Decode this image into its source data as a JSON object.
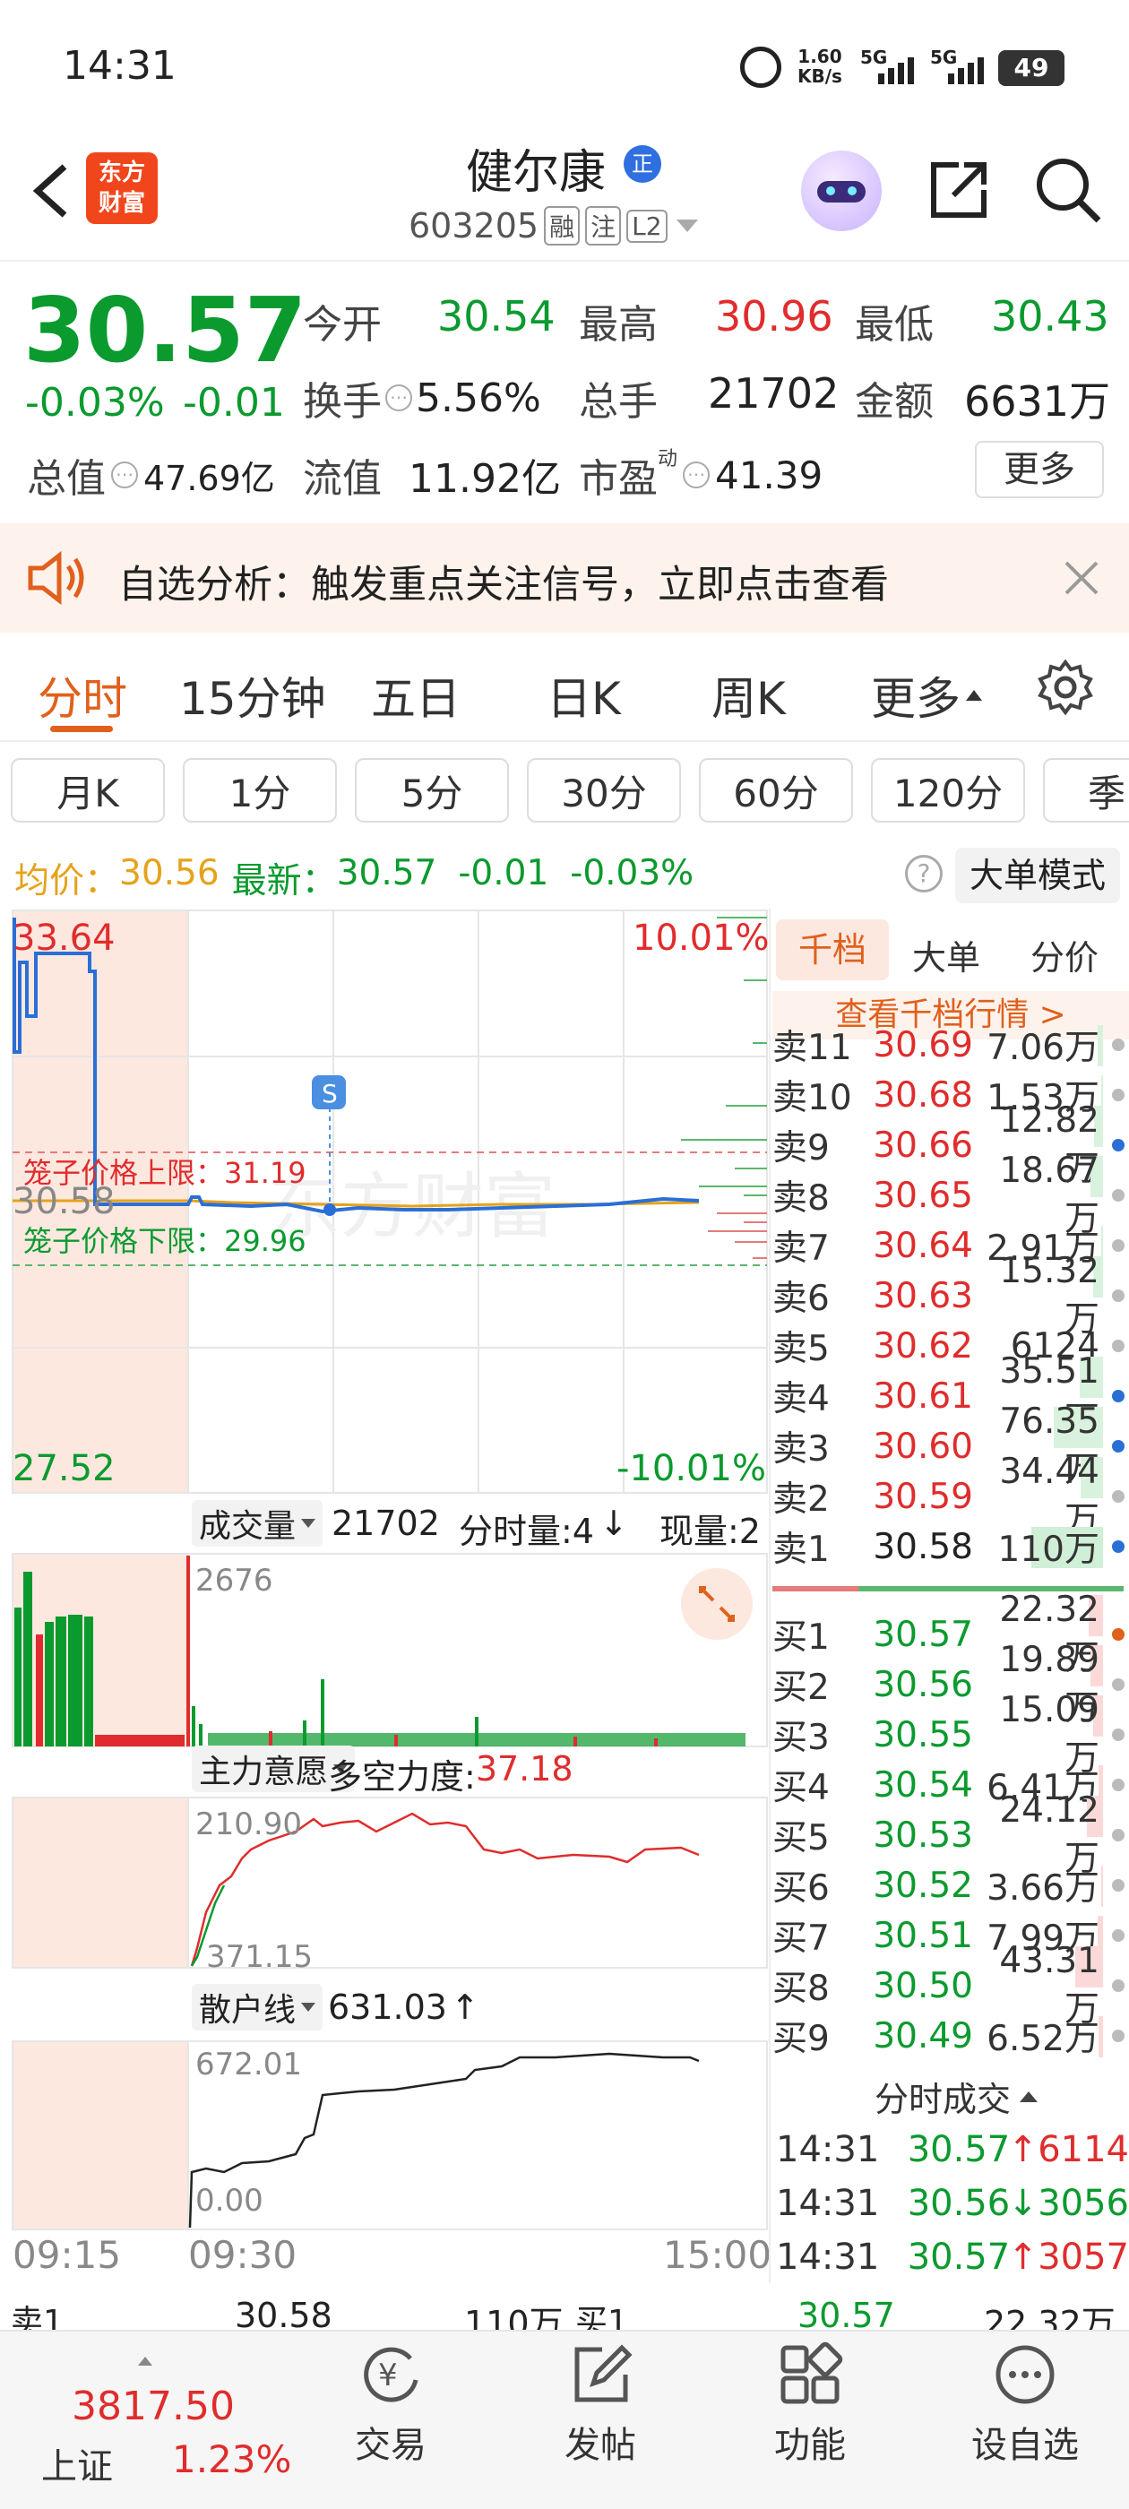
{
  "status_bar": {
    "time": "14:31",
    "speed_value": "1.60",
    "speed_unit": "KB/s",
    "net1": "5G",
    "net2": "5G",
    "battery": "49"
  },
  "header": {
    "logo_line1": "东方",
    "logo_line2": "财富",
    "stock_name": "健尔康",
    "badge": "正",
    "code": "603205",
    "tag_rong": "融",
    "tag_zhu": "注",
    "tag_l2": "L2"
  },
  "quote": {
    "price": "30.57",
    "change_pct": "-0.03%",
    "change": "-0.01",
    "open_label": "今开",
    "open": "30.54",
    "high_label": "最高",
    "high": "30.96",
    "low_label": "最低",
    "low": "30.43",
    "turnover_label": "换手",
    "turnover": "5.56%",
    "volume_label": "总手",
    "volume": "21702",
    "amount_label": "金额",
    "amount": "6631万",
    "mcap_label": "总值",
    "mcap": "47.69亿",
    "float_label": "流值",
    "float_cap": "11.92亿",
    "pe_label": "市盈",
    "pe_sup": "动",
    "pe": "41.39",
    "more_button": "更多"
  },
  "alert": {
    "text": "自选分析：触发重点关注信号，立即点击查看"
  },
  "tabs": [
    {
      "label": "分时"
    },
    {
      "label": "15分钟"
    },
    {
      "label": "五日"
    },
    {
      "label": "日K"
    },
    {
      "label": "周K"
    },
    {
      "label": "更多"
    }
  ],
  "subtabs": [
    {
      "label": "月K"
    },
    {
      "label": "1分"
    },
    {
      "label": "5分"
    },
    {
      "label": "30分"
    },
    {
      "label": "60分"
    },
    {
      "label": "120分"
    },
    {
      "label": "季"
    }
  ],
  "chart_header": {
    "avg_label": "均价：",
    "avg": "30.56",
    "latest_label": "最新：",
    "latest": "30.57",
    "change": "-0.01",
    "change_pct": "-0.03%",
    "mode_button": "大单模式"
  },
  "chart": {
    "top_price": "33.64",
    "top_pct": "10.01%",
    "mid_price": "30.58",
    "bottom_price": "27.52",
    "bottom_pct": "-10.01%",
    "cage_upper": "笼子价格上限：31.19",
    "cage_lower": "笼子价格下限：29.96",
    "marker": "S",
    "watermark": "东方财富",
    "volume_label": "成交量",
    "volume_total": "21702",
    "tick_vol_label": "分时量:4",
    "tick_vol_arrow": "↓",
    "cur_vol_label": "现量:2",
    "vol_max": "2676",
    "main_label": "主力意愿",
    "long_short": "多空力度:",
    "long_short_val": "37.18",
    "main_max": "210.90",
    "main_min": "371.15",
    "retail_label": "散户线",
    "retail_val": "631.03",
    "retail_arrow": "↑",
    "retail_max": "672.01",
    "retail_min": "0.00",
    "time_start": "09:15",
    "time_open": "09:30",
    "time_end": "15:00"
  },
  "chart_data": {
    "type": "line",
    "x": [
      "09:15",
      "09:30",
      "15:00"
    ],
    "series": [],
    "ylim": [
      27.52,
      33.64
    ],
    "annotations": [
      "笼子价格上限：31.19",
      "笼子价格下限：29.96"
    ]
  },
  "orderbook": {
    "tabs": [
      "千档",
      "大单",
      "分价"
    ],
    "link": "查看千档行情 >",
    "asks": [
      {
        "label": "卖11",
        "price": "30.69",
        "vol": "7.06万",
        "bar": 0.08,
        "dot": "#bbb"
      },
      {
        "label": "卖10",
        "price": "30.68",
        "vol": "1.53万",
        "bar": 0.02,
        "dot": "#bbb"
      },
      {
        "label": "卖9",
        "price": "30.66",
        "vol": "12.82万",
        "bar": 0.12,
        "dot": "#2a6fd6"
      },
      {
        "label": "卖8",
        "price": "30.65",
        "vol": "18.67万",
        "bar": 0.17,
        "dot": "#bbb"
      },
      {
        "label": "卖7",
        "price": "30.64",
        "vol": "2.91万",
        "bar": 0.03,
        "dot": "#bbb"
      },
      {
        "label": "卖6",
        "price": "30.63",
        "vol": "15.32万",
        "bar": 0.14,
        "dot": "#bbb"
      },
      {
        "label": "卖5",
        "price": "30.62",
        "vol": "6124",
        "bar": 0.0,
        "dot": "#bbb"
      },
      {
        "label": "卖4",
        "price": "30.61",
        "vol": "35.51万",
        "bar": 0.32,
        "dot": "#2a6fd6"
      },
      {
        "label": "卖3",
        "price": "30.60",
        "vol": "76.35万",
        "bar": 0.69,
        "dot": "#2a6fd6"
      },
      {
        "label": "卖2",
        "price": "30.59",
        "vol": "34.44万",
        "bar": 0.31,
        "dot": "#bbb"
      },
      {
        "label": "卖1",
        "price": "30.58",
        "vol": "110万",
        "bar": 1.0,
        "dot": "#2a6fd6"
      }
    ],
    "bids": [
      {
        "label": "买1",
        "price": "30.57",
        "vol": "22.32万",
        "bar": 0.2,
        "dot": "#e0601c"
      },
      {
        "label": "买2",
        "price": "30.56",
        "vol": "19.89万",
        "bar": 0.18,
        "dot": "#bbb"
      },
      {
        "label": "买3",
        "price": "30.55",
        "vol": "15.09万",
        "bar": 0.14,
        "dot": "#bbb"
      },
      {
        "label": "买4",
        "price": "30.54",
        "vol": "6.41万",
        "bar": 0.06,
        "dot": "#bbb"
      },
      {
        "label": "买5",
        "price": "30.53",
        "vol": "24.12万",
        "bar": 0.22,
        "dot": "#bbb"
      },
      {
        "label": "买6",
        "price": "30.52",
        "vol": "3.66万",
        "bar": 0.03,
        "dot": "#bbb"
      },
      {
        "label": "买7",
        "price": "30.51",
        "vol": "7.99万",
        "bar": 0.07,
        "dot": "#bbb"
      },
      {
        "label": "买8",
        "price": "30.50",
        "vol": "43.31万",
        "bar": 0.39,
        "dot": "#bbb"
      },
      {
        "label": "买9",
        "price": "30.49",
        "vol": "6.52万",
        "bar": 0.06,
        "dot": "#bbb"
      }
    ],
    "ticks_title": "分时成交",
    "ticks": [
      {
        "time": "14:31",
        "price": "30.57",
        "arrow": "↑",
        "vol": "6114"
      },
      {
        "time": "14:31",
        "price": "30.56",
        "arrow": "↓",
        "vol": "3056"
      },
      {
        "time": "14:31",
        "price": "30.57",
        "arrow": "↑",
        "vol": "3057"
      }
    ]
  },
  "bottom_quote": {
    "ask_label": "卖1",
    "ask_price": "30.58",
    "ask_vol": "110万",
    "bid_label": "买1",
    "bid_price": "30.57",
    "bid_vol": "22.32万"
  },
  "nav": {
    "index_value": "3817.50",
    "index_name": "上证",
    "index_pct": "1.23%",
    "trade_icon_text": "¥",
    "items": [
      {
        "label": "交易"
      },
      {
        "label": "发帖"
      },
      {
        "label": "功能"
      },
      {
        "label": "设自选"
      }
    ]
  }
}
